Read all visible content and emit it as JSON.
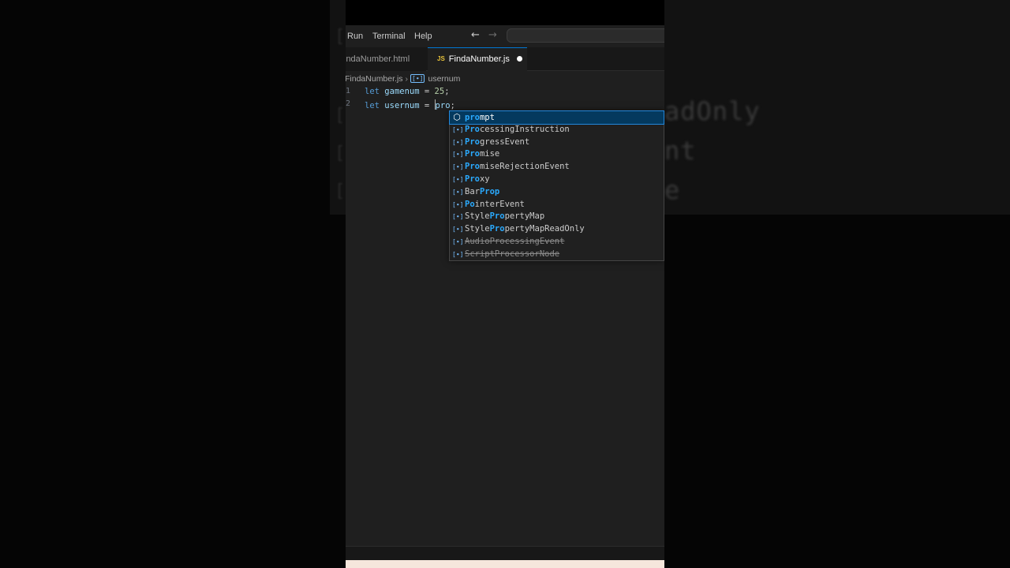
{
  "menu": {
    "run": "Run",
    "terminal": "Terminal",
    "help": "Help",
    "back_icon": "arrow-left-icon",
    "forward_icon": "arrow-right-icon"
  },
  "tabs": [
    {
      "label": "indaNumber.html",
      "active": false
    },
    {
      "label": "FindaNumber.js",
      "active": true,
      "icon": "JS",
      "dirty": true
    }
  ],
  "breadcrumb": {
    "file": "FindaNumber.js",
    "symbol_icon": "[∙]",
    "symbol": "usernum"
  },
  "editor": {
    "lines": [
      {
        "num": "1",
        "keyword": "let",
        "name": "gamenum",
        "op": "=",
        "value": "25",
        "end": ";"
      },
      {
        "num": "2",
        "keyword": "let",
        "name": "usernum",
        "op": "=",
        "typed": "pro",
        "end": ";"
      }
    ],
    "extra_gutter_marks": [
      "",
      ""
    ]
  },
  "suggestions": [
    {
      "match": "pro",
      "rest": "mpt",
      "kind": "module",
      "selected": true,
      "deprecated": false
    },
    {
      "match": "Pro",
      "rest": "cessingInstruction",
      "kind": "variable",
      "selected": false,
      "deprecated": false
    },
    {
      "match": "Pro",
      "rest": "gressEvent",
      "kind": "variable",
      "selected": false,
      "deprecated": false
    },
    {
      "match": "Pro",
      "rest": "mise",
      "kind": "variable",
      "selected": false,
      "deprecated": false
    },
    {
      "match": "Pro",
      "rest": "miseRejectionEvent",
      "kind": "variable",
      "selected": false,
      "deprecated": false
    },
    {
      "match": "Pro",
      "rest": "xy",
      "kind": "variable",
      "selected": false,
      "deprecated": false
    },
    {
      "pre": "Bar",
      "match": "Prop",
      "rest": "",
      "kind": "variable",
      "selected": false,
      "deprecated": false
    },
    {
      "pre": "",
      "match": "Po",
      "rest": "interEvent",
      "kind": "variable",
      "selected": false,
      "deprecated": false
    },
    {
      "pre": "Style",
      "match": "Pro",
      "rest": "pertyMap",
      "kind": "variable",
      "selected": false,
      "deprecated": false
    },
    {
      "pre": "Style",
      "match": "Pro",
      "rest": "pertyMapReadOnly",
      "kind": "variable",
      "selected": false,
      "deprecated": false
    },
    {
      "pre": "AudioProcessingEvent",
      "match": "",
      "rest": "",
      "kind": "variable",
      "selected": false,
      "deprecated": true
    },
    {
      "pre": "ScriptProcessorNode",
      "match": "",
      "rest": "",
      "kind": "variable",
      "selected": false,
      "deprecated": true
    }
  ],
  "background_ghost": {
    "line1": "adOnly",
    "line2": "nt",
    "line3": "e"
  },
  "colors": {
    "accent": "#0078d4",
    "match_highlight": "#2aaaff",
    "selected_row": "#04395e"
  }
}
